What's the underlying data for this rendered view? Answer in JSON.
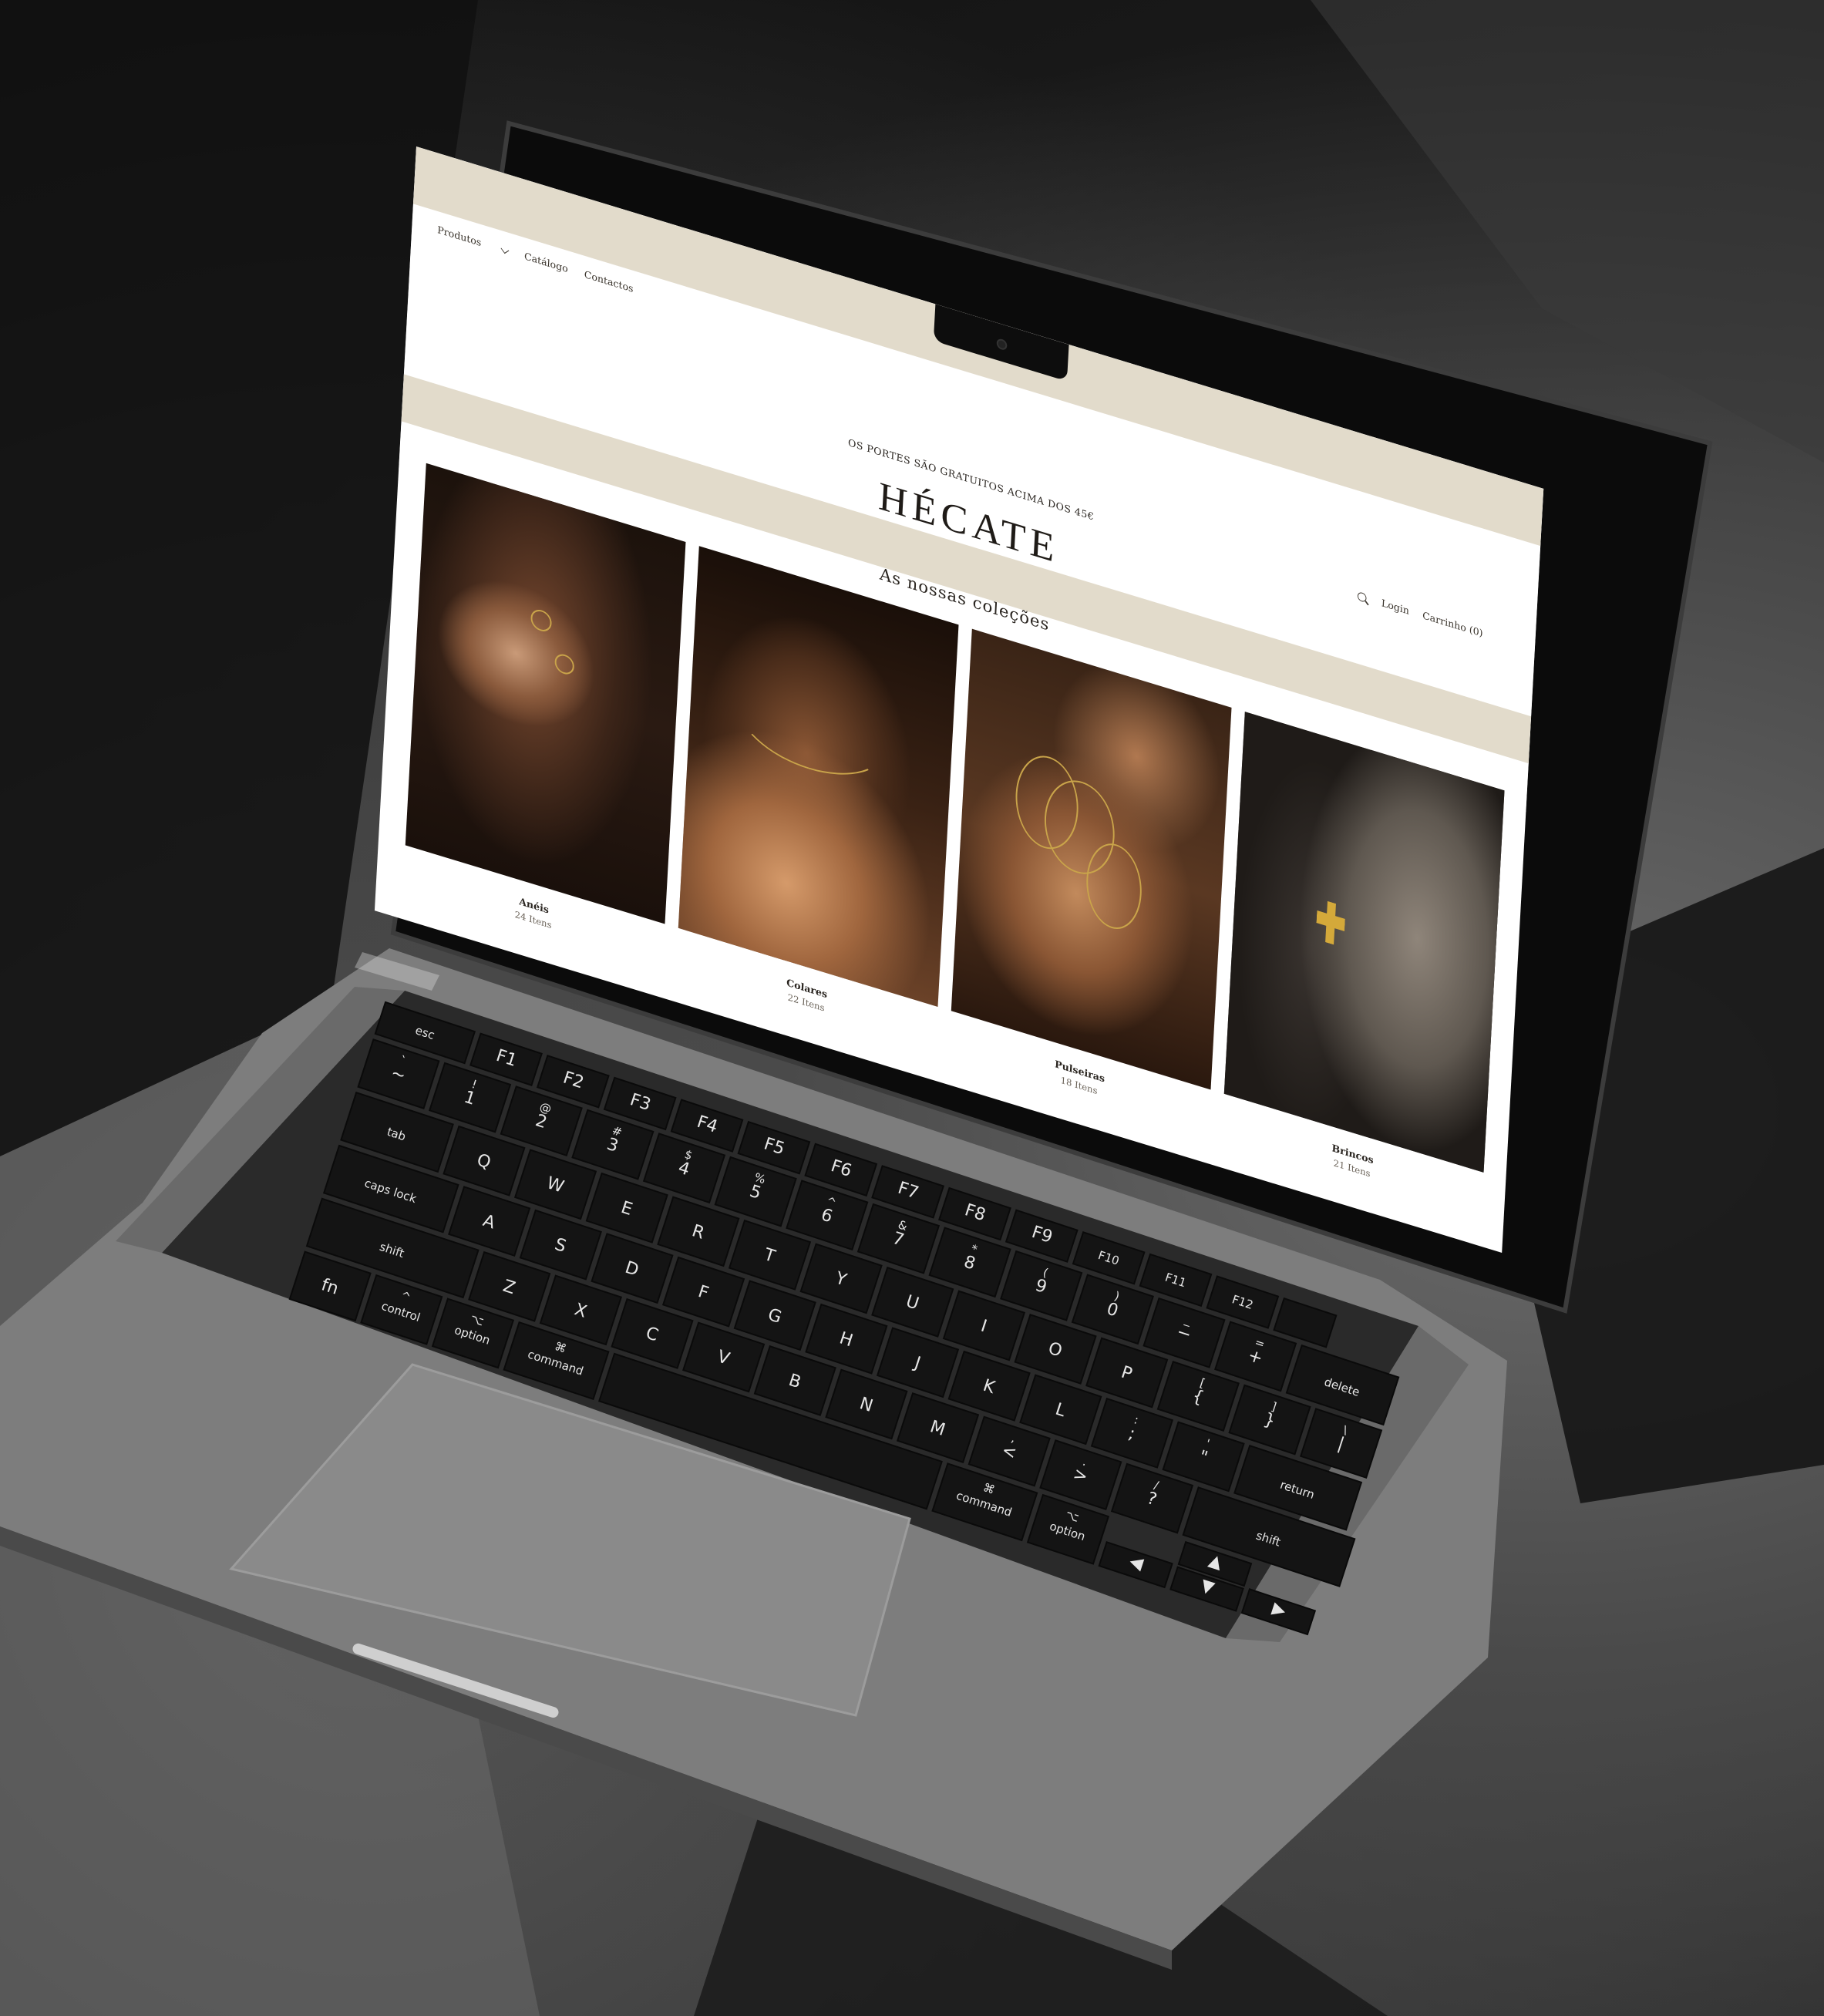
{
  "site": {
    "nav": {
      "products": "Produtos",
      "catalog": "Catálogo",
      "contacts": "Contactos"
    },
    "announcement": "OS PORTES SÃO GRATUITOS ACIMA DOS 45€",
    "logo": "HÉCATE",
    "utility": {
      "login": "Login",
      "cart": "Carrinho (0)"
    },
    "collections_title": "As nossas coleções",
    "collections": [
      {
        "name": "Anéis",
        "count": "24 Itens"
      },
      {
        "name": "Colares",
        "count": "22 Itens"
      },
      {
        "name": "Pulseiras",
        "count": "18 Itens"
      },
      {
        "name": "Brincos",
        "count": "21 Itens"
      }
    ]
  },
  "keyboard": {
    "row_fn": [
      "esc",
      "F1",
      "F2",
      "F3",
      "F4",
      "F5",
      "F6",
      "F7",
      "F8",
      "F9",
      "F10",
      "F11",
      "F12"
    ],
    "row_num": [
      "~",
      "1",
      "2",
      "3",
      "4",
      "5",
      "6",
      "7",
      "8",
      "9",
      "0",
      "−",
      "+",
      "delete"
    ],
    "row_num_shift": [
      "`",
      "!",
      "@",
      "#",
      "$",
      "%",
      "^",
      "&",
      "*",
      "(",
      ")",
      "_",
      "="
    ],
    "row_q": [
      "tab",
      "Q",
      "W",
      "E",
      "R",
      "T",
      "Y",
      "U",
      "I",
      "O",
      "P",
      "{",
      "}",
      "|"
    ],
    "row_q_sub": [
      "[",
      "]",
      "\\"
    ],
    "row_a": [
      "caps lock",
      "A",
      "S",
      "D",
      "F",
      "G",
      "H",
      "J",
      "K",
      "L",
      ";",
      "\"",
      "return"
    ],
    "row_a_sub": [
      ":",
      "'"
    ],
    "row_z": [
      "shift",
      "Z",
      "X",
      "C",
      "V",
      "B",
      "N",
      "M",
      "<",
      ">",
      "?",
      "shift"
    ],
    "row_z_sub": [
      ",",
      ".",
      "/"
    ],
    "row_bottom": [
      "fn",
      "control",
      "option",
      "command",
      "command",
      "option"
    ],
    "symbols": {
      "command": "⌘",
      "option": "⌥",
      "control": "^"
    }
  }
}
